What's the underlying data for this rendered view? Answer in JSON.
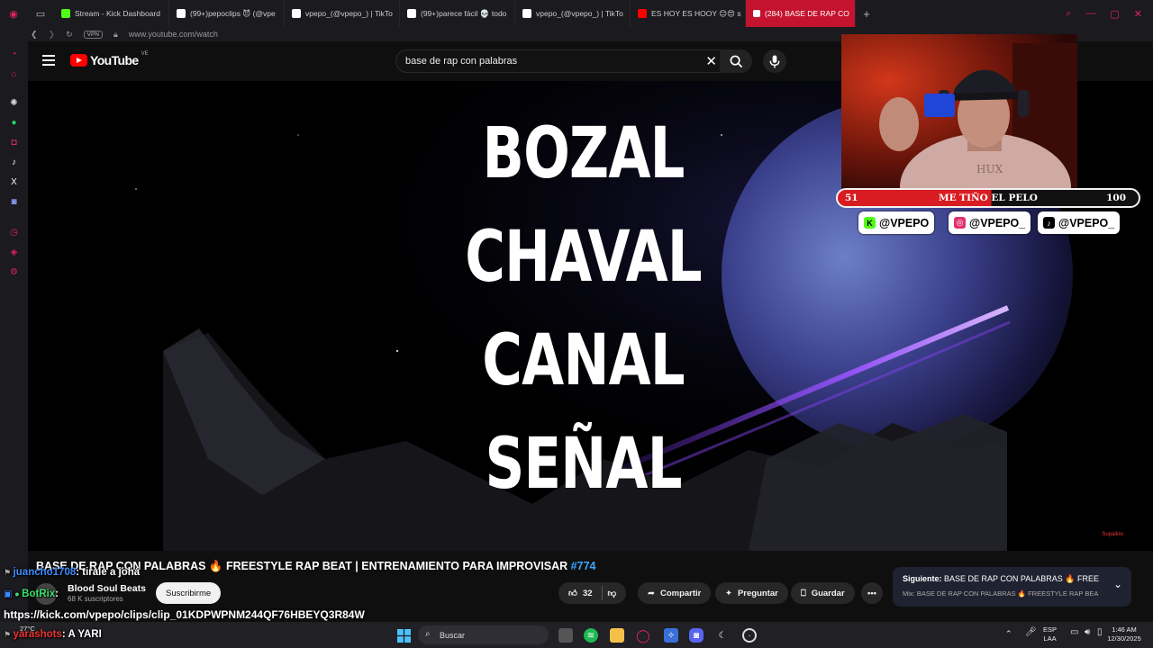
{
  "browser": {
    "tabs": [
      {
        "label": "Stream - Kick Dashboard",
        "color": "#53fc18"
      },
      {
        "label": "(99+)pepoclips 😈 (@vpe",
        "color": "#ffffff"
      },
      {
        "label": "vpepo_(@vpepo_) | TikTo",
        "color": "#ffffff"
      },
      {
        "label": "(99+)parece fácil 💀 todo",
        "color": "#ffffff"
      },
      {
        "label": "vpepo_(@vpepo_) | TikTo",
        "color": "#ffffff"
      },
      {
        "label": "ES HOY ES HOOY 😊😍 s",
        "color": "#ff0000"
      }
    ],
    "active_tab": "(284) BASE DE RAP CO",
    "url": "www.youtube.com/watch",
    "vpn": "VPN"
  },
  "youtube": {
    "logo": "YouTube",
    "country": "VE",
    "search_query": "base de rap con palabras",
    "lyrics": [
      "BOZAL",
      "CHAVAL",
      "CANAL",
      "SEÑAL"
    ],
    "watermark": "Supalkre",
    "video_title": "BASE DE RAP CON PALABRAS 🔥 FREESTYLE RAP BEAT | ENTRENAMIENTO PARA IMPROVISAR",
    "video_tag": "#774",
    "channel_name": "Blood Soul Beats",
    "channel_subs": "68 K suscriptores",
    "subscribe": "Suscribirme",
    "likes": "32",
    "share": "Compartir",
    "ask": "Preguntar",
    "save": "Guardar",
    "up_next_label": "Siguiente:",
    "up_next_title": "BASE DE RAP CON PALABRAS 🔥 FREES...",
    "up_next_mix": "Mix: BASE DE RAP CON PALABRAS 🔥 FREESTYLE RAP BEA..."
  },
  "stream": {
    "goal_current": "51",
    "goal_label": "ME TIÑO EL PELO",
    "goal_target": "100",
    "goal_progress": 0.51,
    "socials": [
      {
        "handle": "@VPEPO",
        "icon": "kick-icon",
        "color": "#53fc18"
      },
      {
        "handle": "@VPEPO_",
        "icon": "instagram-icon",
        "color": "#e1306c"
      },
      {
        "handle": "@VPEPO_",
        "icon": "tiktok-icon",
        "color": "#000000"
      }
    ],
    "chat": [
      {
        "user": "juancho1708",
        "text": ": tirale a johá"
      },
      {
        "user": "BotRix",
        "text": ":"
      },
      {
        "user": "yarashots",
        "text": ": A YARI"
      }
    ],
    "clip_url": "https://kick.com/vpepo/clips/clip_01KDPWPNM244QF76HBEYQ3R84W"
  },
  "taskbar": {
    "weather": "27°C",
    "search": "Buscar",
    "lang1": "ESP",
    "lang2": "LAA",
    "time": "1:46 AM",
    "date": "12/30/2025"
  }
}
